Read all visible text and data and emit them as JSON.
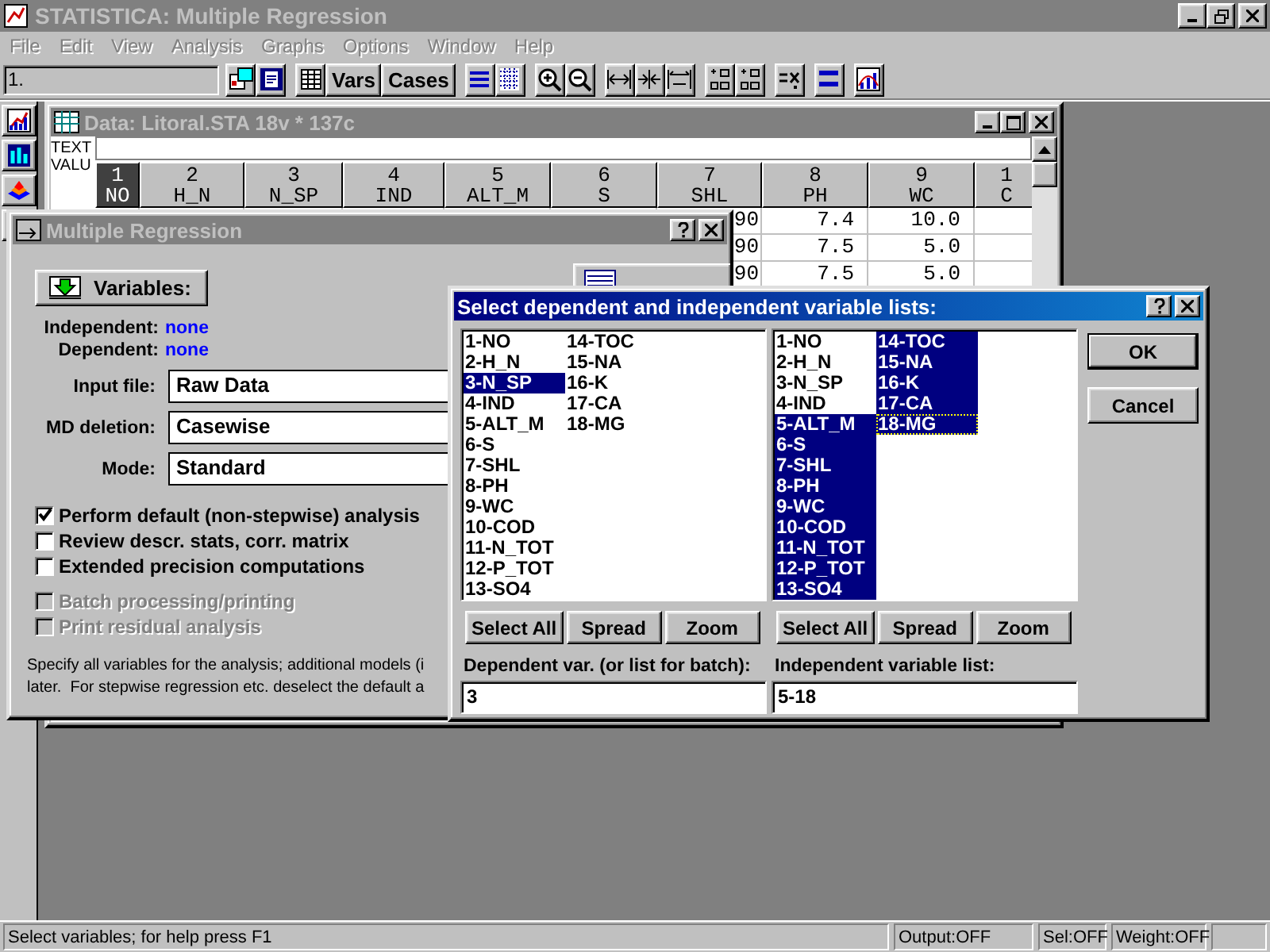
{
  "app_window": {
    "title": "STATISTICA: Multiple Regression"
  },
  "menu": [
    {
      "label": "File",
      "disabled": true
    },
    {
      "label": "Edit",
      "disabled": true
    },
    {
      "label": "View",
      "disabled": true
    },
    {
      "label": "Analysis",
      "disabled": true
    },
    {
      "label": "Graphs",
      "disabled": true
    },
    {
      "label": "Options",
      "disabled": true
    },
    {
      "label": "Window",
      "disabled": true
    },
    {
      "label": "Help",
      "disabled": true
    }
  ],
  "toolbar": {
    "cell_field": "1.",
    "text_buttons": [
      "Vars",
      "Cases"
    ]
  },
  "data_window": {
    "title": "Data: Litoral.STA 18v * 137c",
    "corner_label": [
      "TEXT",
      "VALU"
    ],
    "columns": [
      {
        "number": "1",
        "name": "NO",
        "selected": true
      },
      {
        "number": "2",
        "name": "H_N",
        "selected": false
      },
      {
        "number": "3",
        "name": "N_SP",
        "selected": false
      },
      {
        "number": "4",
        "name": "IND",
        "selected": false
      },
      {
        "number": "5",
        "name": "ALT_M",
        "selected": false
      },
      {
        "number": "6",
        "name": "S",
        "selected": false
      },
      {
        "number": "7",
        "name": "SHL",
        "selected": false
      },
      {
        "number": "8",
        "name": "PH",
        "selected": false
      },
      {
        "number": "9",
        "name": "WC",
        "selected": false
      },
      {
        "number": "1",
        "name": "C",
        "selected": false
      }
    ],
    "rows": [
      {
        "cells": [
          "90",
          "7.4",
          "10.0"
        ]
      },
      {
        "cells": [
          "90",
          "7.5",
          "5.0"
        ]
      },
      {
        "cells": [
          "90",
          "7.5",
          "5.0"
        ]
      }
    ]
  },
  "regression_dialog": {
    "title": "Multiple Regression",
    "variables_button": "Variables:",
    "assignments": [
      {
        "label": "Independent:",
        "value": "none"
      },
      {
        "label": "Dependent:",
        "value": "none"
      }
    ],
    "fields": [
      {
        "label": "Input file:",
        "value": "Raw Data"
      },
      {
        "label": "MD deletion:",
        "value": "Casewise"
      },
      {
        "label": "Mode:",
        "value": "Standard"
      }
    ],
    "options": [
      {
        "label": "Perform default (non-stepwise) analysis",
        "checked": true,
        "disabled": false
      },
      {
        "label": "Review descr. stats, corr. matrix",
        "checked": false,
        "disabled": false
      },
      {
        "label": "Extended precision computations",
        "checked": false,
        "disabled": false
      },
      {
        "label": "Batch processing/printing",
        "checked": false,
        "disabled": true
      },
      {
        "label": "Print residual analysis",
        "checked": false,
        "disabled": true
      }
    ],
    "hint": [
      "Specify all variables for the analysis; additional models (i",
      "later.  For stepwise regression etc. deselect the default a"
    ]
  },
  "select_dialog": {
    "title": "Select dependent and independent variable lists:",
    "lists": [
      {
        "items": [
          {
            "label": "1-NO",
            "selected": false
          },
          {
            "label": "2-H_N",
            "selected": false
          },
          {
            "label": "3-N_SP",
            "selected": true
          },
          {
            "label": "4-IND",
            "selected": false
          },
          {
            "label": "5-ALT_M",
            "selected": false
          },
          {
            "label": "6-S",
            "selected": false
          },
          {
            "label": "7-SHL",
            "selected": false
          },
          {
            "label": "8-PH",
            "selected": false
          },
          {
            "label": "9-WC",
            "selected": false
          },
          {
            "label": "10-COD",
            "selected": false
          },
          {
            "label": "11-N_TOT",
            "selected": false
          },
          {
            "label": "12-P_TOT",
            "selected": false
          },
          {
            "label": "13-SO4",
            "selected": false
          },
          {
            "label": "14-TOC",
            "selected": false
          },
          {
            "label": "15-NA",
            "selected": false
          },
          {
            "label": "16-K",
            "selected": false
          },
          {
            "label": "17-CA",
            "selected": false
          },
          {
            "label": "18-MG",
            "selected": false
          }
        ],
        "buttons": [
          "Select All",
          "Spread",
          "Zoom"
        ],
        "field_label": "Dependent var. (or list for batch):",
        "field_value": "3"
      },
      {
        "items": [
          {
            "label": "1-NO",
            "selected": false
          },
          {
            "label": "2-H_N",
            "selected": false
          },
          {
            "label": "3-N_SP",
            "selected": false
          },
          {
            "label": "4-IND",
            "selected": false
          },
          {
            "label": "5-ALT_M",
            "selected": true
          },
          {
            "label": "6-S",
            "selected": true
          },
          {
            "label": "7-SHL",
            "selected": true
          },
          {
            "label": "8-PH",
            "selected": true
          },
          {
            "label": "9-WC",
            "selected": true
          },
          {
            "label": "10-COD",
            "selected": true
          },
          {
            "label": "11-N_TOT",
            "selected": true
          },
          {
            "label": "12-P_TOT",
            "selected": true
          },
          {
            "label": "13-SO4",
            "selected": true
          },
          {
            "label": "14-TOC",
            "selected": true
          },
          {
            "label": "15-NA",
            "selected": true
          },
          {
            "label": "16-K",
            "selected": true
          },
          {
            "label": "17-CA",
            "selected": true
          },
          {
            "label": "18-MG",
            "selected": true,
            "focused": true
          }
        ],
        "buttons": [
          "Select All",
          "Spread",
          "Zoom"
        ],
        "field_label": "Independent variable list:",
        "field_value": "5-18"
      }
    ],
    "buttons": [
      "OK",
      "Cancel"
    ]
  },
  "status_bar": [
    "Select variables; for help press F1",
    "Output:OFF",
    "Sel:OFF",
    "Weight:OFF"
  ]
}
